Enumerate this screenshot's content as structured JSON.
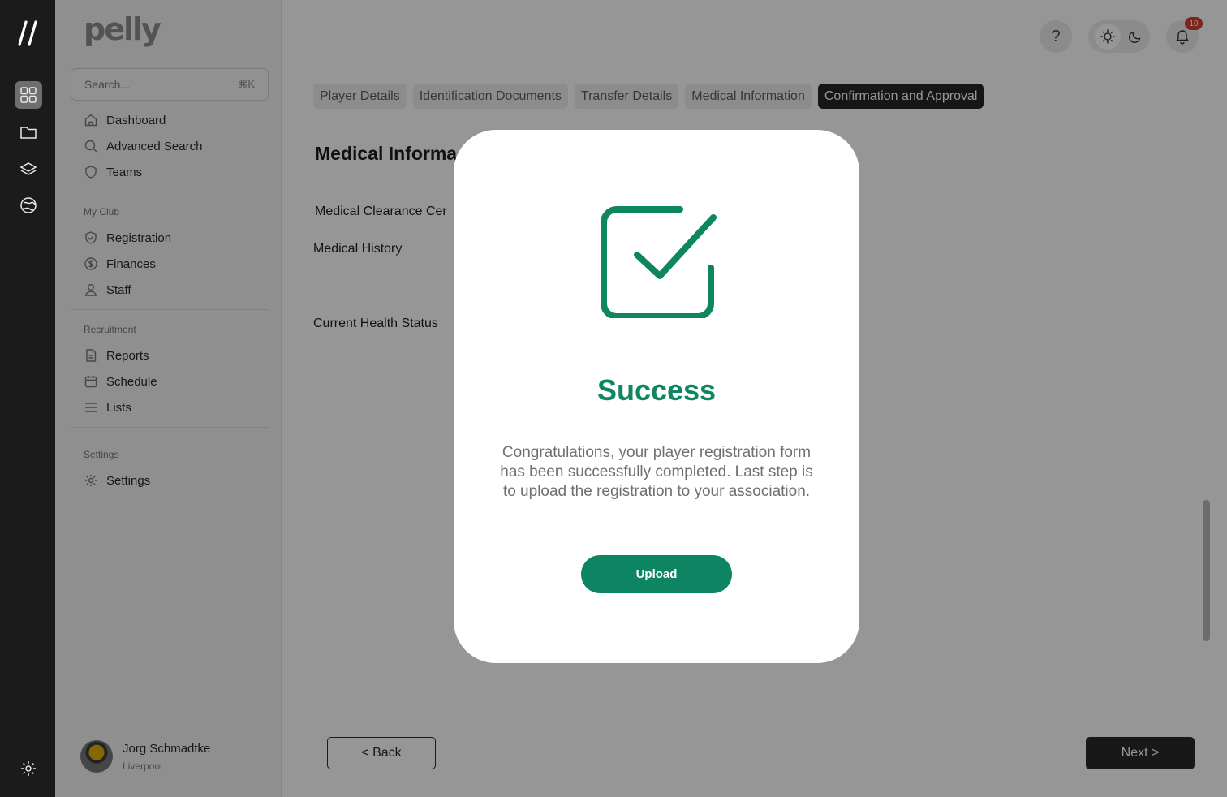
{
  "app": {
    "brand": "pelly",
    "search_placeholder": "Search...",
    "search_shortcut": "⌘K"
  },
  "rail": {
    "items": [
      "grid-icon",
      "folder-icon",
      "layers-icon",
      "globe-icon",
      "settings-icon"
    ]
  },
  "sidebar": {
    "nav": [
      {
        "label": "Dashboard",
        "icon": "home-icon"
      },
      {
        "label": "Advanced Search",
        "icon": "search-icon"
      },
      {
        "label": "Teams",
        "icon": "shield-icon"
      }
    ],
    "my_club_label": "My Club",
    "my_club": [
      {
        "label": "Registration",
        "icon": "shield-check-icon"
      },
      {
        "label": "Finances",
        "icon": "dollar-icon"
      },
      {
        "label": "Staff",
        "icon": "user-icon"
      }
    ],
    "recruitment_label": "Recruitment",
    "recruitment": [
      {
        "label": "Reports",
        "icon": "document-icon"
      },
      {
        "label": "Schedule",
        "icon": "calendar-icon"
      },
      {
        "label": "Lists",
        "icon": "list-icon"
      }
    ],
    "settings_label": "Settings",
    "settings": [
      {
        "label": "Settings",
        "icon": "gear-icon"
      }
    ],
    "user": {
      "name": "Jorg Schmadtke",
      "club": "Liverpool"
    }
  },
  "header": {
    "help": "?",
    "notifications_count": "10"
  },
  "tabs": [
    {
      "label": "Player Details",
      "active": false
    },
    {
      "label": "Identification Documents",
      "active": false
    },
    {
      "label": "Transfer Details",
      "active": false
    },
    {
      "label": "Medical Information",
      "active": false
    },
    {
      "label": "Confirmation and Approval",
      "active": true
    }
  ],
  "form": {
    "title": "Medical Informa",
    "fields": [
      "Medical Clearance Cer",
      "Medical History",
      "Current Health Status"
    ],
    "back_label": "< Back",
    "next_label": "Next >"
  },
  "modal": {
    "title": "Success",
    "message": "Congratulations, your player registration form has been successfully completed. Last step is to upload the registration to your association.",
    "upload_label": "Upload",
    "accent_color": "#0e8562"
  }
}
